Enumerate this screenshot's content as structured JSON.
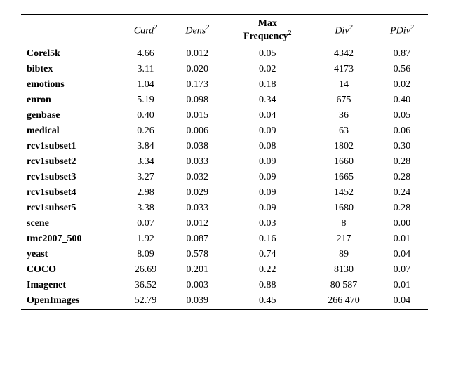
{
  "table": {
    "columns": [
      {
        "key": "name",
        "label": "",
        "superscript": "",
        "bold": false,
        "italic": false
      },
      {
        "key": "card",
        "label": "Card",
        "superscript": "2",
        "bold": false,
        "italic": true
      },
      {
        "key": "dens",
        "label": "Dens",
        "superscript": "2",
        "bold": false,
        "italic": true
      },
      {
        "key": "maxfreq",
        "label": "Max Frequency",
        "superscript": "2",
        "bold": true,
        "italic": false
      },
      {
        "key": "div",
        "label": "Div",
        "superscript": "2",
        "bold": false,
        "italic": true
      },
      {
        "key": "pdiv",
        "label": "PDiv",
        "superscript": "2",
        "bold": false,
        "italic": true
      }
    ],
    "rows": [
      {
        "name": "Corel5k",
        "card": "4.66",
        "dens": "0.012",
        "maxfreq": "0.05",
        "div": "4342",
        "pdiv": "0.87"
      },
      {
        "name": "bibtex",
        "card": "3.11",
        "dens": "0.020",
        "maxfreq": "0.02",
        "div": "4173",
        "pdiv": "0.56"
      },
      {
        "name": "emotions",
        "card": "1.04",
        "dens": "0.173",
        "maxfreq": "0.18",
        "div": "14",
        "pdiv": "0.02"
      },
      {
        "name": "enron",
        "card": "5.19",
        "dens": "0.098",
        "maxfreq": "0.34",
        "div": "675",
        "pdiv": "0.40"
      },
      {
        "name": "genbase",
        "card": "0.40",
        "dens": "0.015",
        "maxfreq": "0.04",
        "div": "36",
        "pdiv": "0.05"
      },
      {
        "name": "medical",
        "card": "0.26",
        "dens": "0.006",
        "maxfreq": "0.09",
        "div": "63",
        "pdiv": "0.06"
      },
      {
        "name": "rcv1subset1",
        "card": "3.84",
        "dens": "0.038",
        "maxfreq": "0.08",
        "div": "1802",
        "pdiv": "0.30"
      },
      {
        "name": "rcv1subset2",
        "card": "3.34",
        "dens": "0.033",
        "maxfreq": "0.09",
        "div": "1660",
        "pdiv": "0.28"
      },
      {
        "name": "rcv1subset3",
        "card": "3.27",
        "dens": "0.032",
        "maxfreq": "0.09",
        "div": "1665",
        "pdiv": "0.28"
      },
      {
        "name": "rcv1subset4",
        "card": "2.98",
        "dens": "0.029",
        "maxfreq": "0.09",
        "div": "1452",
        "pdiv": "0.24"
      },
      {
        "name": "rcv1subset5",
        "card": "3.38",
        "dens": "0.033",
        "maxfreq": "0.09",
        "div": "1680",
        "pdiv": "0.28"
      },
      {
        "name": "scene",
        "card": "0.07",
        "dens": "0.012",
        "maxfreq": "0.03",
        "div": "8",
        "pdiv": "0.00"
      },
      {
        "name": "tmc2007_500",
        "card": "1.92",
        "dens": "0.087",
        "maxfreq": "0.16",
        "div": "217",
        "pdiv": "0.01"
      },
      {
        "name": "yeast",
        "card": "8.09",
        "dens": "0.578",
        "maxfreq": "0.74",
        "div": "89",
        "pdiv": "0.04"
      },
      {
        "name": "COCO",
        "card": "26.69",
        "dens": "0.201",
        "maxfreq": "0.22",
        "div": "8130",
        "pdiv": "0.07"
      },
      {
        "name": "Imagenet",
        "card": "36.52",
        "dens": "0.003",
        "maxfreq": "0.88",
        "div": "80 587",
        "pdiv": "0.01"
      },
      {
        "name": "OpenImages",
        "card": "52.79",
        "dens": "0.039",
        "maxfreq": "0.45",
        "div": "266 470",
        "pdiv": "0.04"
      }
    ]
  }
}
